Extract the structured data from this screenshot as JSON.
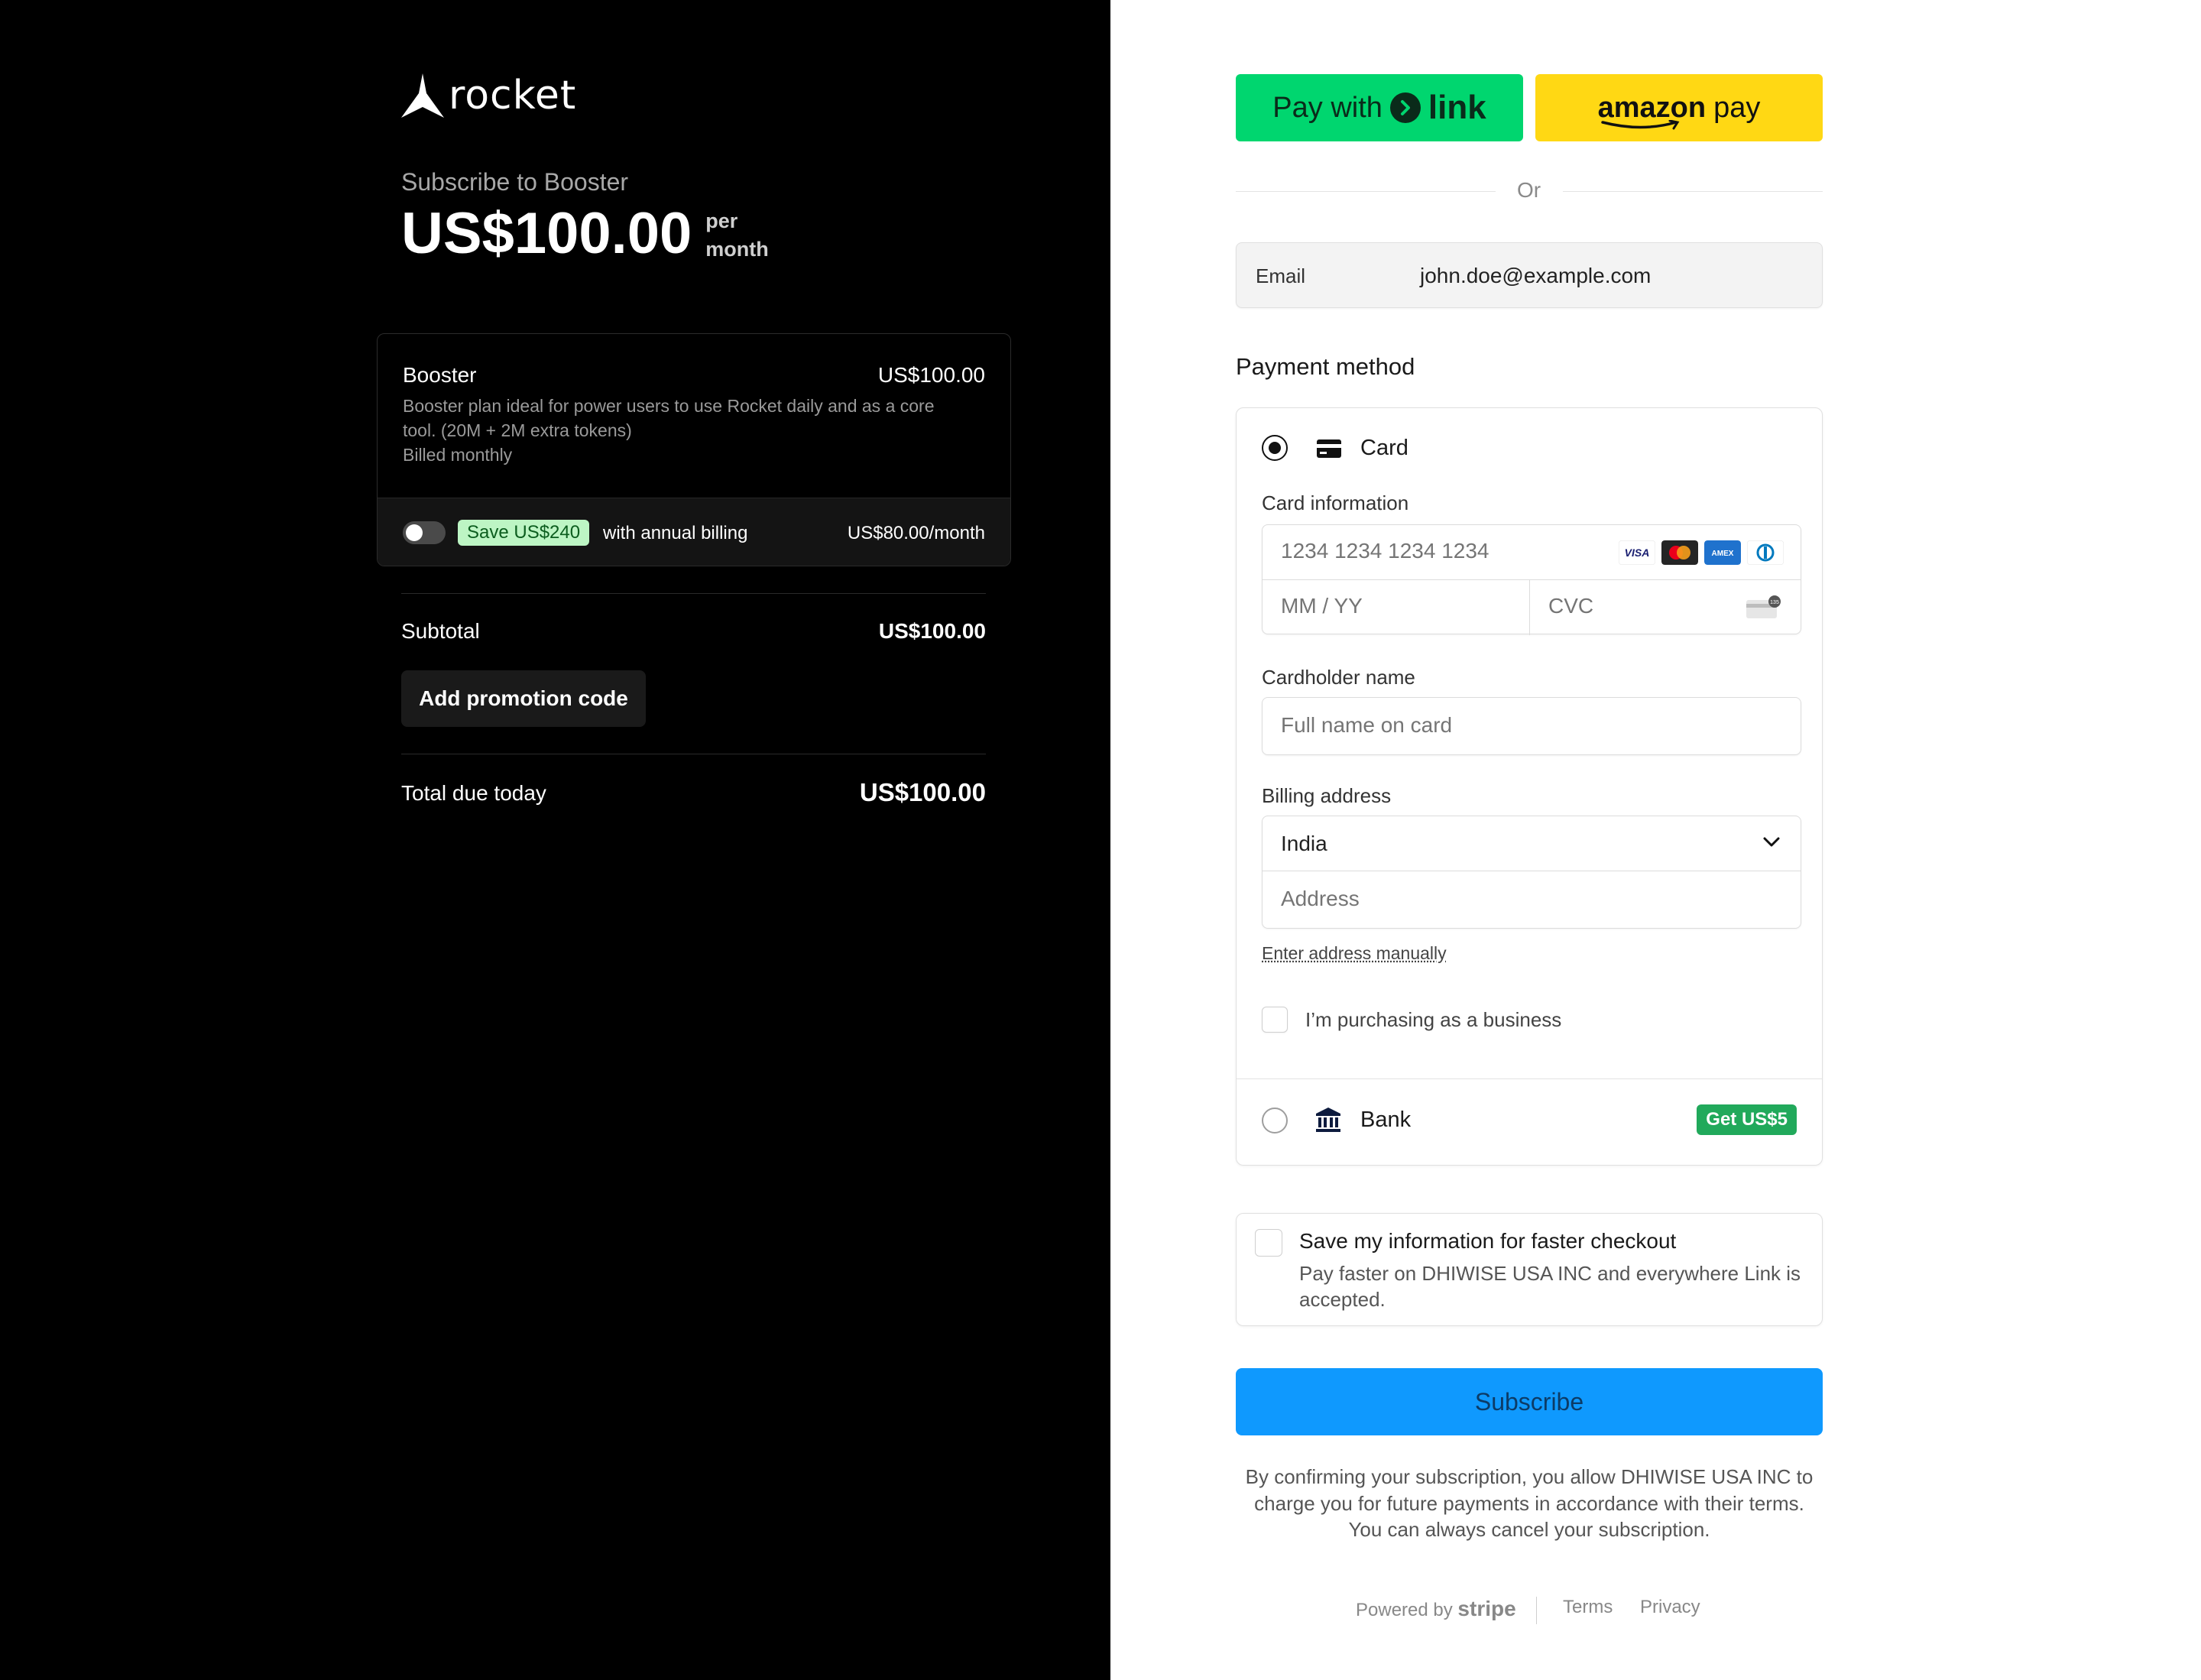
{
  "brand": {
    "name": "rocket"
  },
  "summary": {
    "subscribe_to": "Subscribe to Booster",
    "price": "US$100.00",
    "per_line1": "per",
    "per_line2": "month"
  },
  "plan": {
    "name": "Booster",
    "price": "US$100.00",
    "description": "Booster plan ideal for power users to use Rocket daily and as a core tool. (20M + 2M extra tokens)",
    "billed": "Billed monthly",
    "annual_toggle_on": false,
    "save_badge": "Save US$240",
    "save_text": "with annual billing",
    "annual_price": "US$80.00/month"
  },
  "totals": {
    "subtotal_label": "Subtotal",
    "subtotal_value": "US$100.00",
    "promo_label": "Add promotion code",
    "total_label": "Total due today",
    "total_value": "US$100.00"
  },
  "express": {
    "link_prefix": "Pay with",
    "link_word": "link",
    "amazon_word": "amazon",
    "amazon_pay": "pay",
    "or": "Or",
    "link_color": "#00d66f",
    "amazon_color": "#ffd814"
  },
  "email": {
    "label": "Email",
    "value": "john.doe@example.com"
  },
  "payment": {
    "title": "Payment method",
    "card_label": "Card",
    "card_info_label": "Card information",
    "card_number_placeholder": "1234 1234 1234 1234",
    "expiry_placeholder": "MM / YY",
    "cvc_placeholder": "CVC",
    "card_brands": [
      "visa",
      "mastercard",
      "amex",
      "diners"
    ],
    "cardholder_label": "Cardholder name",
    "cardholder_placeholder": "Full name on card",
    "billing_label": "Billing address",
    "country": "India",
    "address_placeholder": "Address",
    "enter_manually": "Enter address manually",
    "business_label": "I’m purchasing as a business",
    "bank_label": "Bank",
    "bank_badge": "Get US$5"
  },
  "save_info": {
    "title": "Save my information for faster checkout",
    "description": "Pay faster on DHIWISE USA INC and everywhere Link is accepted."
  },
  "subscribe": {
    "label": "Subscribe",
    "color": "#0f99fe",
    "confirm": "By confirming your subscription, you allow DHIWISE USA INC to charge you for future payments in accordance with their terms. You can always cancel your subscription."
  },
  "footer": {
    "powered_by": "Powered by",
    "stripe": "stripe",
    "terms": "Terms",
    "privacy": "Privacy"
  }
}
